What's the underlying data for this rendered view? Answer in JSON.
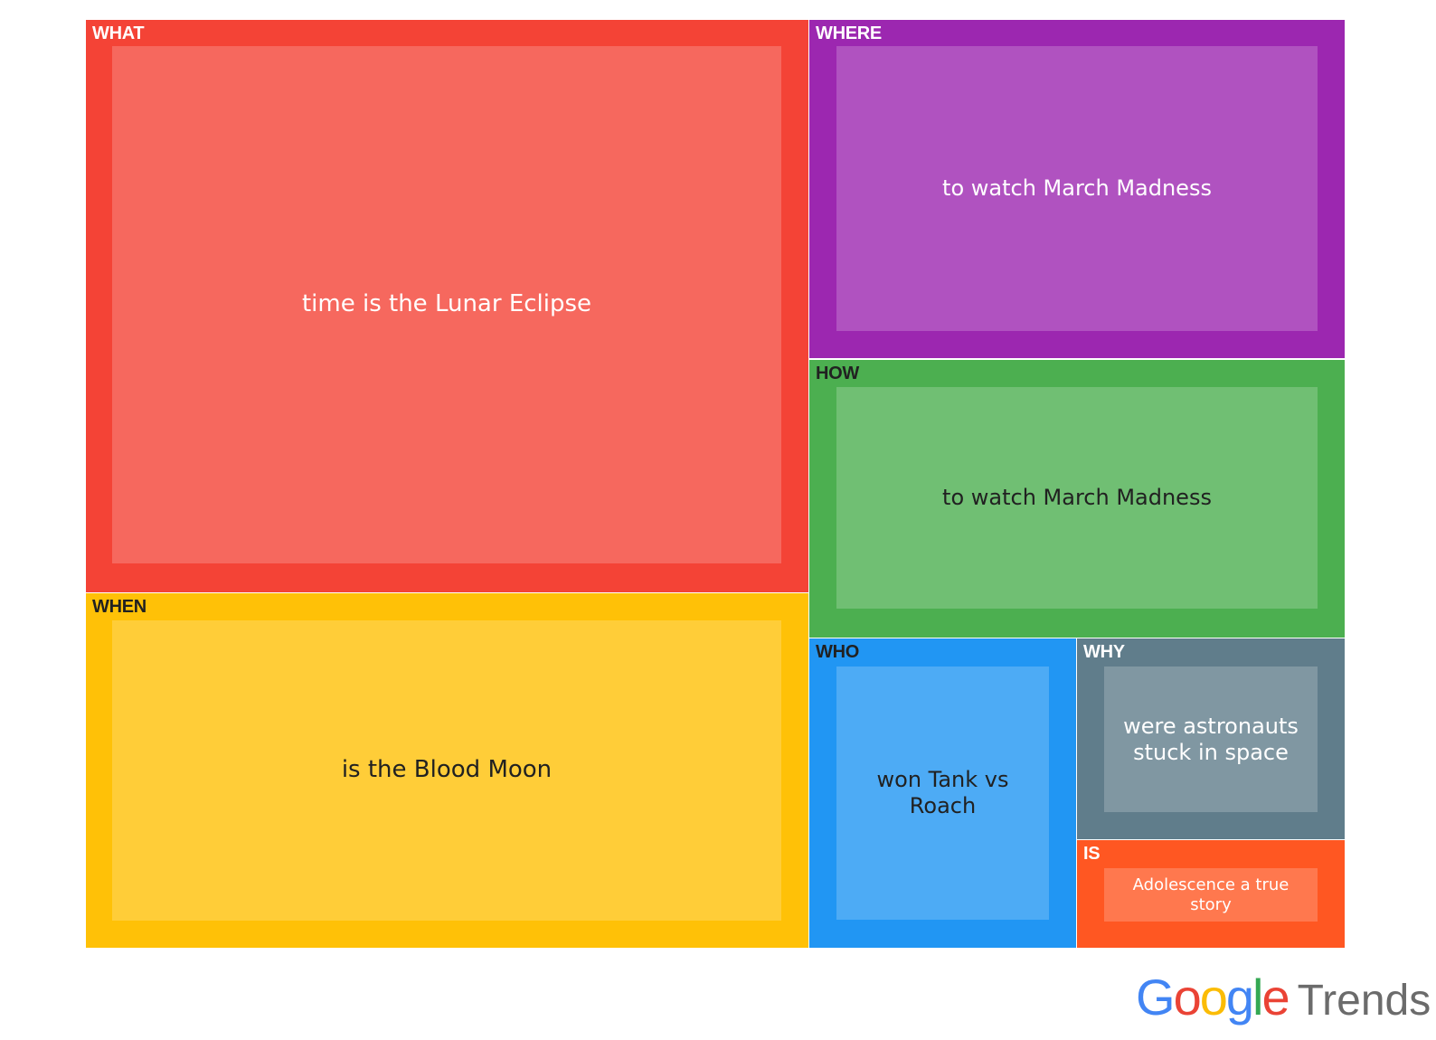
{
  "chart_data": {
    "type": "treemap",
    "cells": [
      {
        "category": "WHAT",
        "query": "time is the Lunar Eclipse",
        "color": "#F44336",
        "inner_color": "#F6685E",
        "text_color": "#ffffff",
        "label_color": "#ffffff"
      },
      {
        "category": "WHEN",
        "query": "is the Blood Moon",
        "color": "#FFC107",
        "inner_color": "#FFCD38",
        "text_color": "#212121",
        "label_color": "#212121"
      },
      {
        "category": "WHERE",
        "query": "to watch March Madness",
        "color": "#9C27B0",
        "inner_color": "#B052C0",
        "text_color": "#ffffff",
        "label_color": "#ffffff"
      },
      {
        "category": "HOW",
        "query": "to watch March Madness",
        "color": "#4CAF50",
        "inner_color": "#70BF73",
        "text_color": "#212121",
        "label_color": "#212121"
      },
      {
        "category": "WHO",
        "query": "won Tank vs Roach",
        "color": "#2196F3",
        "inner_color": "#4DABF5",
        "text_color": "#212121",
        "label_color": "#212121"
      },
      {
        "category": "WHY",
        "query": "were astronauts stuck in space",
        "color": "#607D8B",
        "inner_color": "#8097A2",
        "text_color": "#ffffff",
        "label_color": "#ffffff"
      },
      {
        "category": "IS",
        "query": "Adolescence a true story",
        "color": "#FF5722",
        "inner_color": "#FF784E",
        "text_color": "#ffffff",
        "label_color": "#ffffff"
      }
    ]
  },
  "logo": {
    "google": "Google",
    "trends": "Trends",
    "letter_colors": [
      "#4285F4",
      "#EA4335",
      "#FBBC05",
      "#4285F4",
      "#34A853",
      "#EA4335"
    ]
  }
}
